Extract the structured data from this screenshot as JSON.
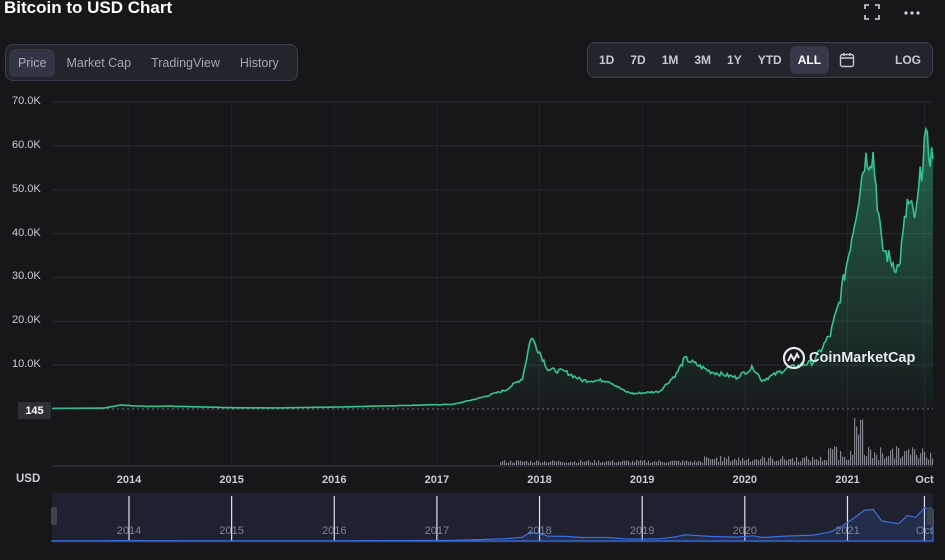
{
  "title": "Bitcoin to USD Chart",
  "tabs": [
    {
      "label": "Price",
      "active": true
    },
    {
      "label": "Market Cap",
      "active": false
    },
    {
      "label": "TradingView",
      "active": false
    },
    {
      "label": "History",
      "active": false
    }
  ],
  "ranges": [
    {
      "label": "1D",
      "active": false
    },
    {
      "label": "7D",
      "active": false
    },
    {
      "label": "1M",
      "active": false
    },
    {
      "label": "3M",
      "active": false
    },
    {
      "label": "1Y",
      "active": false
    },
    {
      "label": "YTD",
      "active": false
    },
    {
      "label": "ALL",
      "active": true
    }
  ],
  "log_label": "LOG",
  "currency_label": "USD",
  "current_price_badge": "145",
  "watermark": "CoinMarketCap",
  "colors": {
    "line": "#35c48f",
    "navigator_line": "#3b6fe0",
    "background": "#17171a"
  },
  "chart_data": {
    "type": "area",
    "yticks": [
      "70.0K",
      "60.0K",
      "50.0K",
      "40.0K",
      "30.0K",
      "20.0K",
      "10.0K"
    ],
    "ytick_values": [
      70000,
      60000,
      50000,
      40000,
      30000,
      20000,
      10000
    ],
    "ylim": [
      0,
      72000
    ],
    "xticks": [
      "2014",
      "2015",
      "2016",
      "2017",
      "2018",
      "2019",
      "2020",
      "2021",
      "Oct"
    ],
    "xtick_values": [
      "2014-01",
      "2015-01",
      "2016-01",
      "2017-01",
      "2018-01",
      "2019-01",
      "2020-01",
      "2021-01",
      "2021-10"
    ],
    "x_range": [
      "2013-04",
      "2021-11"
    ],
    "series": [
      {
        "x": [
          "2013-04",
          "2013-10",
          "2013-12",
          "2014-03",
          "2014-06",
          "2015-01",
          "2015-06",
          "2016-01",
          "2016-06",
          "2017-01",
          "2017-03",
          "2017-06",
          "2017-09",
          "2017-11",
          "2017-12",
          "2018-01",
          "2018-02",
          "2018-04",
          "2018-06",
          "2018-09",
          "2018-11",
          "2018-12",
          "2019-03",
          "2019-05",
          "2019-06",
          "2019-09",
          "2019-12",
          "2020-02",
          "2020-03",
          "2020-06",
          "2020-09",
          "2020-11",
          "2020-12",
          "2021-01",
          "2021-02",
          "2021-03",
          "2021-04",
          "2021-05",
          "2021-06",
          "2021-07",
          "2021-08",
          "2021-09",
          "2021-10",
          "2021-11"
        ],
        "y": [
          145,
          200,
          900,
          600,
          640,
          300,
          250,
          430,
          670,
          970,
          1100,
          2500,
          4300,
          7000,
          16500,
          13000,
          9000,
          8500,
          6500,
          6500,
          4000,
          3500,
          4000,
          8000,
          11500,
          8500,
          7200,
          9500,
          6500,
          9300,
          10700,
          17000,
          24000,
          34000,
          45000,
          57000,
          58000,
          37000,
          34000,
          32000,
          47000,
          43500,
          61000,
          57000
        ]
      }
    ]
  }
}
